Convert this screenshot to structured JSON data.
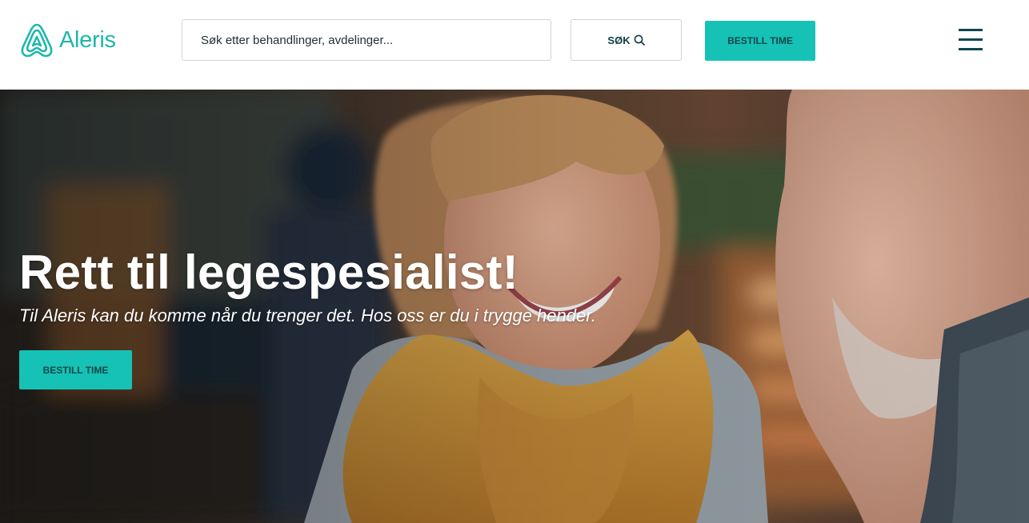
{
  "colors": {
    "brand": "#1fb7ad",
    "cta_background": "#16c2b5",
    "cta_text": "#12474a",
    "navy": "#0f4650"
  },
  "header": {
    "logo_text": "Aleris",
    "search": {
      "placeholder": "Søk etter behandlinger, avdelinger...",
      "button_label": "SØK",
      "icon": "search-icon"
    },
    "book_button_label": "BESTILL TIME",
    "menu_icon": "hamburger-menu-icon"
  },
  "hero": {
    "title": "Rett til legespesialist!",
    "subtitle": "Til Aleris kan du komme når du trenger det. Hos oss er du i trygge hender.",
    "book_button_label": "BESTILL TIME",
    "image": "smiling-couple-photo"
  }
}
